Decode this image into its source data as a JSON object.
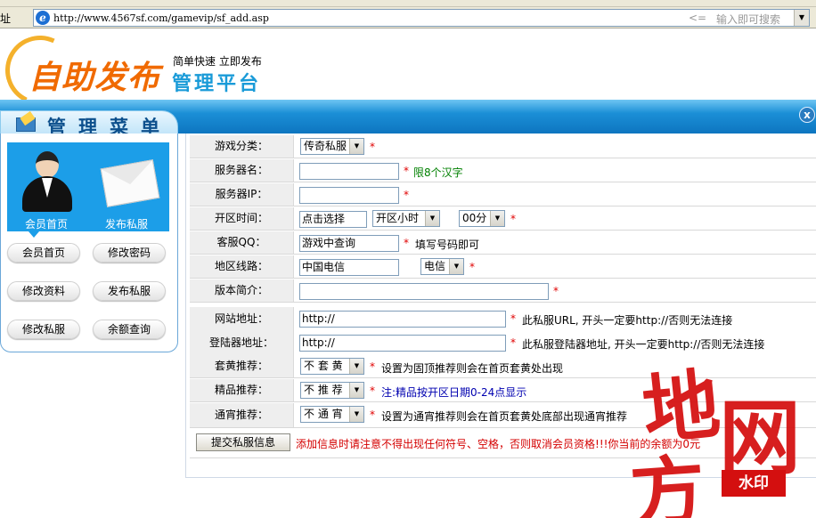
{
  "browser": {
    "address_label": "址",
    "url": "http://www.4567sf.com/gamevip/sf_add.asp",
    "search_arrow": "<=",
    "search_placeholder": "输入即可搜索"
  },
  "logo": {
    "main": "自助发布",
    "slogan": "简单快速 立即发布",
    "sub": "管理平台"
  },
  "banner": {
    "title": "管理菜单",
    "close": "x"
  },
  "sidebar": {
    "tab_member": "会员首页",
    "tab_publish": "发布私服",
    "buttons": [
      "会员首页",
      "修改密码",
      "修改资料",
      "发布私服",
      "修改私服",
      "余额查询"
    ]
  },
  "form": {
    "rows": [
      {
        "label": "游戏分类：",
        "select": "传奇私服",
        "hint": ""
      },
      {
        "label": "服务器名：",
        "value": "",
        "hint": "限8个汉字"
      },
      {
        "label": "服务器IP：",
        "value": ""
      },
      {
        "label": "开区时间：",
        "value": "点击选择",
        "hour": "开区小时",
        "minute": "00分"
      },
      {
        "label": "客服QQ：",
        "value": "游戏中查询",
        "hint": "填写号码即可"
      },
      {
        "label": "地区线路：",
        "value": "中国电信",
        "select": "电信"
      },
      {
        "label": "版本简介：",
        "value": ""
      },
      {
        "label": "网站地址：",
        "value": "http://",
        "hint": "此私服URL, 开头一定要http://否则无法连接"
      },
      {
        "label": "登陆器地址：",
        "value": "http://",
        "hint": "此私服登陆器地址, 开头一定要http://否则无法连接"
      },
      {
        "label": "套黄推荐：",
        "select": "不 套 黄",
        "hint": "设置为固顶推荐则会在首页套黄处出现"
      },
      {
        "label": "精品推荐：",
        "select": "不 推 荐",
        "hint": "注:精品按开区日期0-24点显示"
      },
      {
        "label": "通宵推荐：",
        "select": "不 通 宵",
        "hint": "设置为通宵推荐则会在首页套黄处底部出现通宵推荐"
      }
    ],
    "star": "*",
    "submit_label": "提交私服信息",
    "submit_note": "添加信息时请注意不得出现任何符号、空格，否则取消会员资格!!!你当前的余额为0元"
  },
  "watermark": {
    "chars": [
      "地",
      "方",
      "网"
    ],
    "badge": "水印"
  },
  "colors": {
    "banner_blue": "#1b8fd6",
    "logo_orange": "#f06a00",
    "hint_red": "#e00000",
    "watermark_red": "#d40f0f"
  }
}
